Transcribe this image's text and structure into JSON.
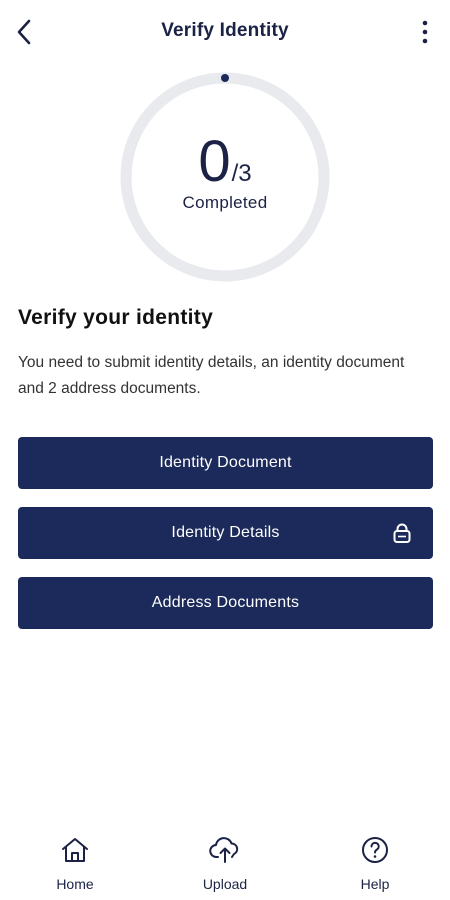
{
  "header": {
    "title": "Verify Identity",
    "back_icon": "chevron-left-icon",
    "more_icon": "more-vertical-icon"
  },
  "progress": {
    "completed": "0",
    "total": "/3",
    "label": "Completed",
    "fraction": 0
  },
  "section": {
    "title": "Verify your identity",
    "description": "You need to submit identity details, an identity document and 2 address documents."
  },
  "actions": [
    {
      "label": "Identity Document",
      "locked": false
    },
    {
      "label": "Identity Details",
      "locked": true,
      "icon": "lock-icon"
    },
    {
      "label": "Address Documents",
      "locked": false
    }
  ],
  "bottom_nav": [
    {
      "label": "Home",
      "icon": "home-icon"
    },
    {
      "label": "Upload",
      "icon": "cloud-upload-icon"
    },
    {
      "label": "Help",
      "icon": "help-circle-icon"
    }
  ],
  "colors": {
    "primary": "#1b2a5a",
    "text_dark": "#1b2245",
    "ring_track": "#e8eaee",
    "background": "#ffffff"
  }
}
